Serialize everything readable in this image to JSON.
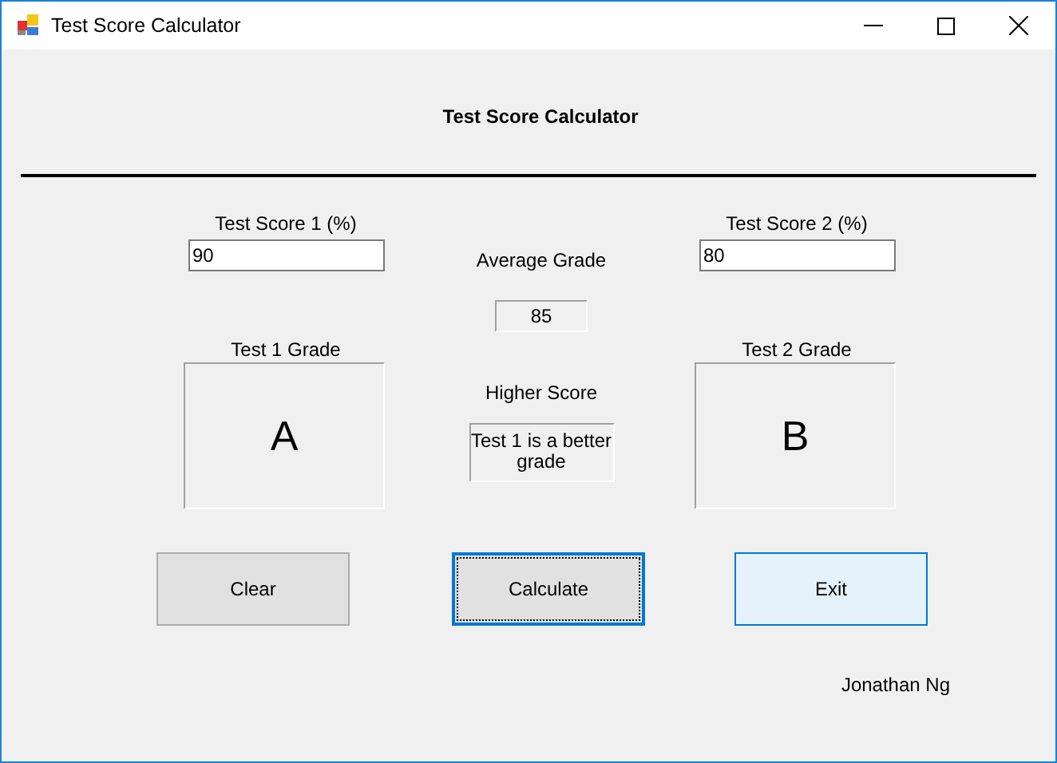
{
  "window": {
    "title": "Test Score Calculator"
  },
  "heading": "Test Score Calculator",
  "score1": {
    "label": "Test Score 1 (%)",
    "value": "90"
  },
  "score2": {
    "label": "Test Score 2 (%)",
    "value": "80"
  },
  "average": {
    "label": "Average Grade",
    "value": "85"
  },
  "grade1": {
    "label": "Test 1 Grade",
    "value": "A"
  },
  "grade2": {
    "label": "Test 2 Grade",
    "value": "B"
  },
  "higher": {
    "label": "Higher Score",
    "value": "Test 1 is a better grade"
  },
  "buttons": [
    {
      "label": "Clear",
      "focused": false,
      "hovered": false
    },
    {
      "label": "Calculate",
      "focused": true,
      "hovered": false
    },
    {
      "label": "Exit",
      "focused": false,
      "hovered": true
    }
  ],
  "author": "Jonathan Ng"
}
